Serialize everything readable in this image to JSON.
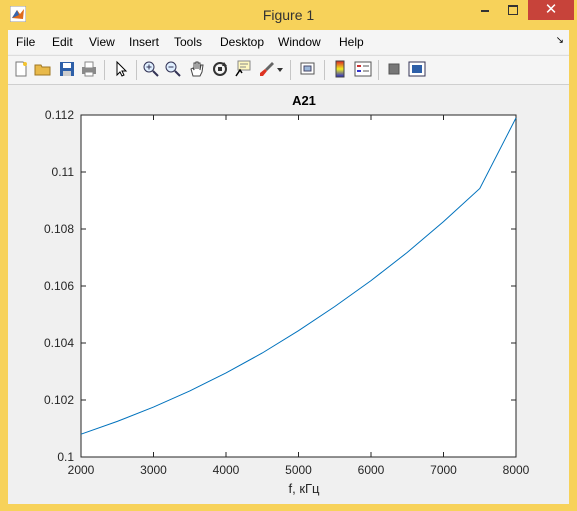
{
  "window": {
    "title": "Figure 1",
    "close_glyph": "✕"
  },
  "menu": [
    "File",
    "Edit",
    "View",
    "Insert",
    "Tools",
    "Desktop",
    "Window",
    "Help"
  ],
  "menu_dock_glyph": "↘",
  "toolbar": {
    "icons": [
      "new-figure-icon",
      "open-file-icon",
      "save-icon",
      "print-icon",
      "pointer-icon",
      "zoom-in-icon",
      "zoom-out-icon",
      "pan-icon",
      "rotate-icon",
      "data-cursor-icon",
      "brush-icon",
      "brush-dropdown-icon",
      "link-plot-icon",
      "colorbar-icon",
      "legend-icon",
      "hide-plot-tools-icon",
      "show-plot-tools-icon"
    ]
  },
  "chart_data": {
    "type": "line",
    "title": "A21",
    "xlabel": "f, кГц",
    "ylabel": "",
    "xlim": [
      2000,
      8000
    ],
    "ylim": [
      0.1,
      0.112
    ],
    "xticks": [
      2000,
      3000,
      4000,
      5000,
      6000,
      7000,
      8000
    ],
    "xtick_labels": [
      "2000",
      "3000",
      "4000",
      "5000",
      "6000",
      "7000",
      "8000"
    ],
    "yticks": [
      0.1,
      0.102,
      0.104,
      0.106,
      0.108,
      0.11,
      0.112
    ],
    "ytick_labels": [
      "0.1",
      "0.102",
      "0.104",
      "0.106",
      "0.108",
      "0.11",
      "0.112"
    ],
    "grid": false,
    "series": [
      {
        "color": "#0072bd",
        "x": [
          2000,
          2500,
          3000,
          3500,
          4000,
          4500,
          5000,
          5500,
          6000,
          6500,
          7000,
          7500,
          8000
        ],
        "y": [
          0.1008,
          0.10125,
          0.10175,
          0.10232,
          0.10295,
          0.10365,
          0.10443,
          0.10528,
          0.10619,
          0.10718,
          0.10826,
          0.10942,
          0.1119
        ]
      }
    ]
  }
}
